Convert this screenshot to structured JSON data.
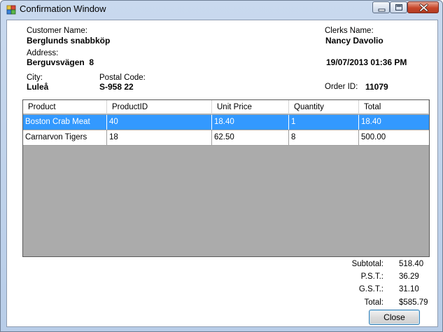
{
  "window": {
    "title": "Confirmation Window"
  },
  "customer": {
    "name_label": "Customer Name:",
    "name": "Berglunds snabbköp",
    "address_label": "Address:",
    "address": "Berguvsvägen  8",
    "city_label": "City:",
    "city": "Luleå",
    "postal_label": "Postal Code:",
    "postal": "S-958 22"
  },
  "clerk": {
    "label": "Clerks Name:",
    "name": "Nancy Davolio",
    "datetime": "19/07/2013 01:36 PM",
    "order_label": "Order ID:",
    "order_id": "11079"
  },
  "grid": {
    "columns": [
      "Product",
      "ProductID",
      "Unit Price",
      "Quantity",
      "Total"
    ],
    "rows": [
      [
        "Boston Crab Meat",
        "40",
        "18.40",
        "1",
        "18.40"
      ],
      [
        "Carnarvon Tigers",
        "18",
        "62.50",
        "8",
        "500.00"
      ]
    ],
    "selected_row": 0
  },
  "summary": {
    "subtotal_label": "Subtotal:",
    "subtotal": "518.40",
    "pst_label": "P.S.T.:",
    "pst": "36.29",
    "gst_label": "G.S.T.:",
    "gst": "31.10",
    "total_label": "Total:",
    "total": "$585.79"
  },
  "buttons": {
    "close": "Close"
  },
  "icons": {
    "app": "app-window-icon",
    "minimize": "minimize-icon",
    "maximize": "maximize-icon",
    "close": "close-icon"
  },
  "colors": {
    "selection": "#3399ff",
    "grid_background": "#ababab",
    "close_caption": "#c8472b"
  }
}
